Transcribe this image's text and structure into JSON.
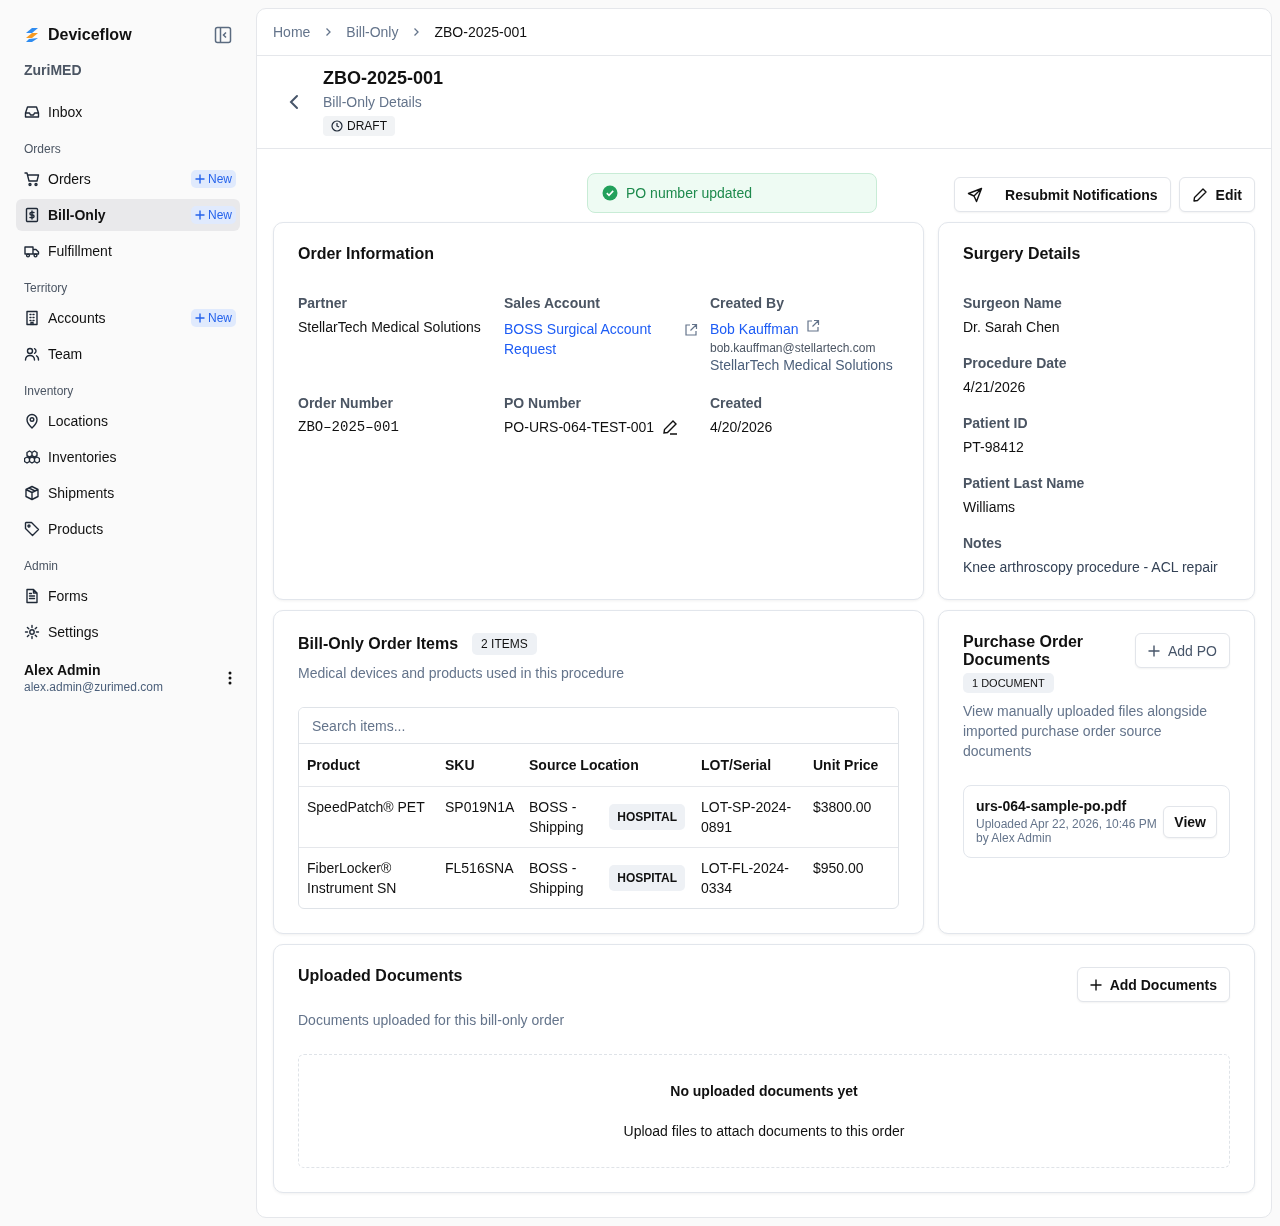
{
  "sidebar": {
    "brand": "Deviceflow",
    "org": "ZuriMED",
    "sections": [
      {
        "items": [
          {
            "label": "Inbox",
            "selected": false
          }
        ]
      },
      {
        "title": "Orders",
        "items": [
          {
            "label": "Orders",
            "selected": false,
            "badge": "New"
          },
          {
            "label": "Bill-Only",
            "selected": true,
            "badge": "New"
          },
          {
            "label": "Fulfillment",
            "selected": false
          }
        ]
      },
      {
        "title": "Territory",
        "items": [
          {
            "label": "Accounts",
            "selected": false,
            "badge": "New"
          },
          {
            "label": "Team",
            "selected": false
          }
        ]
      },
      {
        "title": "Inventory",
        "items": [
          {
            "label": "Locations",
            "selected": false
          },
          {
            "label": "Inventories",
            "selected": false
          },
          {
            "label": "Shipments",
            "selected": false
          },
          {
            "label": "Products",
            "selected": false
          }
        ]
      },
      {
        "title": "Admin",
        "items": [
          {
            "label": "Forms",
            "selected": false
          },
          {
            "label": "Settings",
            "selected": false
          }
        ]
      }
    ],
    "user": {
      "name": "Alex Admin",
      "email": "alex.admin@zurimed.com"
    }
  },
  "breadcrumb": [
    "Home",
    "Bill-Only",
    "ZBO-2025-001"
  ],
  "header": {
    "title": "ZBO-2025-001",
    "subtitle": "Bill-Only Details",
    "status": "DRAFT"
  },
  "actions": [
    "Resubmit Notifications",
    "Edit"
  ],
  "toast": {
    "text": "PO number updated"
  },
  "order_info": {
    "title": "Order Information",
    "fields": [
      {
        "kind": "text",
        "label": "Partner",
        "value": "StellarTech Medical Solutions"
      },
      {
        "kind": "link",
        "label": "Sales Account",
        "value": "BOSS Surgical Account Request"
      },
      {
        "kind": "person",
        "label": "Created By",
        "value": "Bob Kauffman",
        "email": "bob.kauffman@stellartech.com",
        "company": "StellarTech Medical Solutions"
      },
      {
        "kind": "mono",
        "label": "Order Number",
        "value": "ZBO–2025–001"
      },
      {
        "kind": "editable",
        "label": "PO Number",
        "value": "PO-URS-064-TEST-001"
      },
      {
        "kind": "text",
        "label": "Created",
        "value": "4/20/2026"
      }
    ]
  },
  "surgery": {
    "title": "Surgery Details",
    "fields": [
      {
        "label": "Surgeon Name",
        "value": "Dr. Sarah Chen"
      },
      {
        "label": "Procedure Date",
        "value": "4/21/2026"
      },
      {
        "label": "Patient ID",
        "value": "PT-98412"
      },
      {
        "label": "Patient Last Name",
        "value": "Williams"
      },
      {
        "label": "Notes",
        "value": "Knee arthroscopy procedure - ACL repair"
      }
    ]
  },
  "items": {
    "title": "Bill-Only Order Items",
    "count": "2 ITEMS",
    "subtitle": "Medical devices and products used in this procedure",
    "search": {
      "placeholder": "Search items..."
    },
    "columns": [
      "Product",
      "SKU",
      "Source Location",
      "LOT/Serial",
      "Unit Price"
    ],
    "rows": [
      {
        "product": "SpeedPatch® PET",
        "sku": "SP019N1A",
        "location": "BOSS - Shipping",
        "tag": "HOSPITAL",
        "lot": "LOT-SP-2024-0891",
        "price": "$3800.00"
      },
      {
        "product": "FiberLocker® Instrument SN",
        "sku": "FL516SNA",
        "location": "BOSS - Shipping",
        "tag": "HOSPITAL",
        "lot": "LOT-FL-2024-0334",
        "price": "$950.00"
      }
    ]
  },
  "po_docs": {
    "title": "Purchase Order Documents",
    "count": "1 DOCUMENT",
    "add": "Add PO",
    "description": "View manually uploaded files alongside imported purchase order source documents",
    "files": [
      {
        "name": "urs-064-sample-po.pdf",
        "meta": "Uploaded Apr 22, 2026, 10:46 PM by Alex Admin",
        "action": "View"
      }
    ]
  },
  "uploaded": {
    "title": "Uploaded Documents",
    "subtitle": "Documents uploaded for this bill-only order",
    "add": "Add Documents",
    "empty_title": "No uploaded documents yet",
    "empty_text": "Upload files to attach documents to this order"
  }
}
